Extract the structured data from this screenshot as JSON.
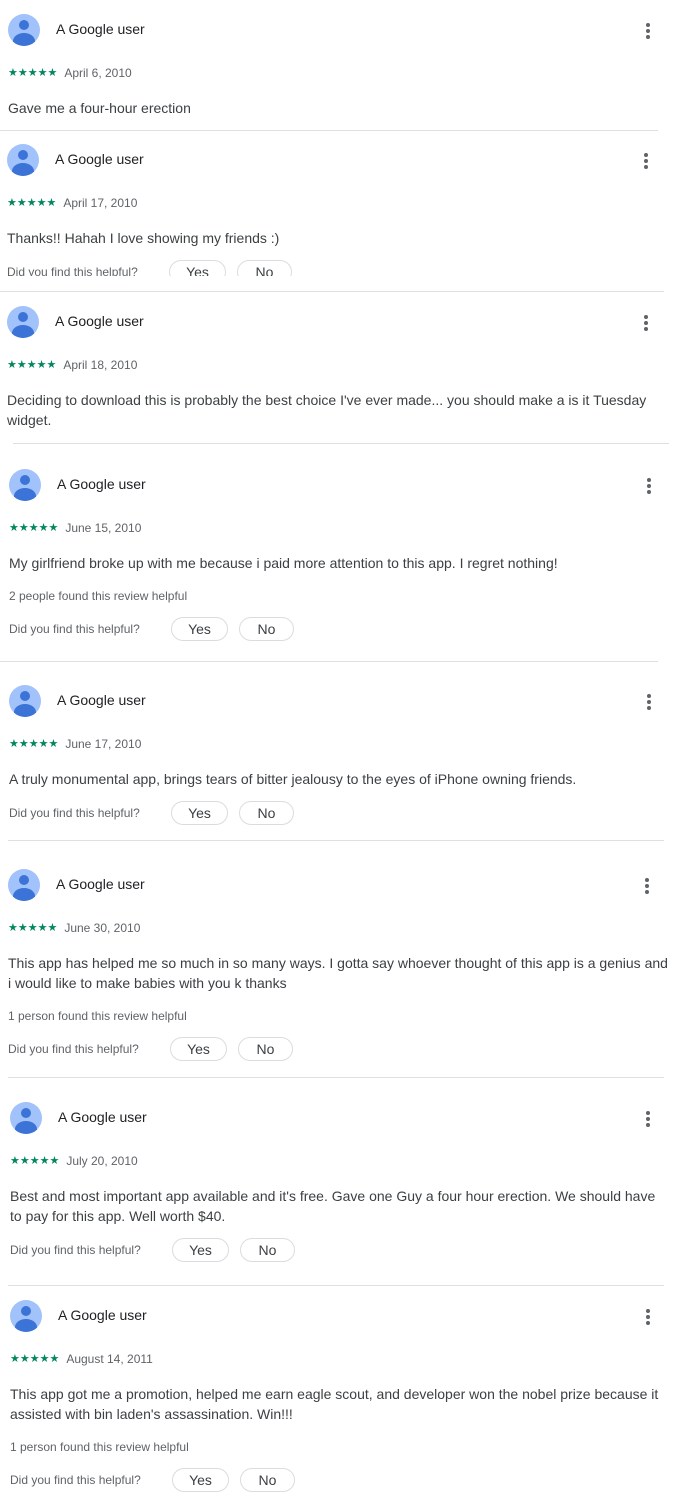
{
  "reviews": [
    {
      "author": "A Google user",
      "rating": "★★★★★",
      "date": "April 6, 2010",
      "text": "Gave me a four-hour erection"
    },
    {
      "author": "A Google user",
      "rating": "★★★★★",
      "date": "April 17, 2010",
      "text": "Thanks!! Hahah I love showing my friends :)",
      "helpful_question": "Did you find this helpful?",
      "yes": "Yes",
      "no": "No"
    },
    {
      "author": "A Google user",
      "rating": "★★★★★",
      "date": "April 18, 2010",
      "text": "Deciding to download this is probably the best choice I've ever made... you should make a is it Tuesday widget."
    },
    {
      "author": "A Google user",
      "rating": "★★★★★",
      "date": "June 15, 2010",
      "text": "My girlfriend broke up with me because i paid more attention to this app. I regret nothing!",
      "helpful_count": "2 people found this review helpful",
      "helpful_question": "Did you find this helpful?",
      "yes": "Yes",
      "no": "No"
    },
    {
      "author": "A Google user",
      "rating": "★★★★★",
      "date": "June 17, 2010",
      "text": "A truly monumental app, brings tears of bitter jealousy to the eyes of iPhone owning friends.",
      "helpful_question": "Did you find this helpful?",
      "yes": "Yes",
      "no": "No"
    },
    {
      "author": "A Google user",
      "rating": "★★★★★",
      "date": "June 30, 2010",
      "text": "This app has helped me so much in so many ways. I gotta say whoever thought of this app is a genius and i would like to make babies with you k thanks",
      "helpful_count": "1 person found this review helpful",
      "helpful_question": "Did you find this helpful?",
      "yes": "Yes",
      "no": "No"
    },
    {
      "author": "A Google user",
      "rating": "★★★★★",
      "date": "July 20, 2010",
      "text": "Best and most important app available and it's free. Gave one Guy a four hour erection. We should have to pay for this app. Well worth $40.",
      "helpful_question": "Did you find this helpful?",
      "yes": "Yes",
      "no": "No"
    },
    {
      "author": "A Google user",
      "rating": "★★★★★",
      "date": "August 14, 2011",
      "text": "This app got me a promotion, helped me earn eagle scout, and developer won the nobel prize because it assisted with bin laden's assassination. Win!!!",
      "helpful_count": "1 person found this review helpful",
      "helpful_question": "Did you find this helpful?",
      "yes": "Yes",
      "no": "No"
    }
  ],
  "colors": {
    "star": "#01875f",
    "avatar_bg": "#a1c2fa",
    "avatar_fg": "#3b73d6",
    "divider": "#e0e0e0"
  }
}
